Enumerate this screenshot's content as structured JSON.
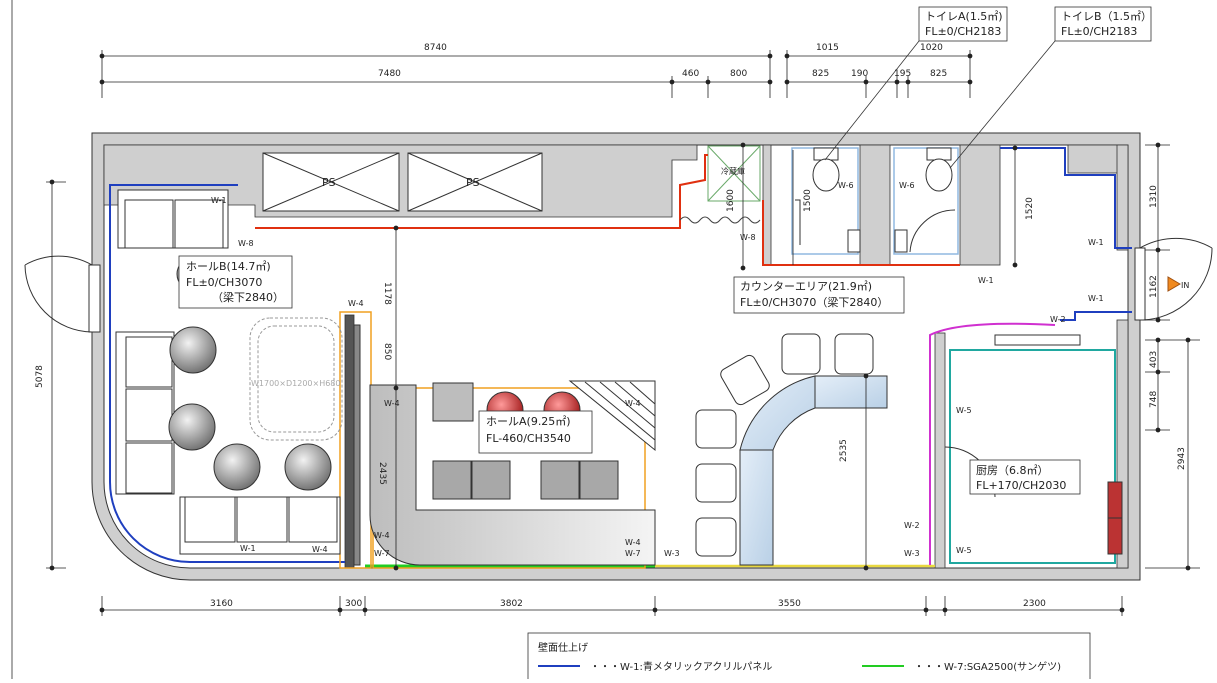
{
  "dims_top": {
    "d8740": "8740",
    "d1015": "1015",
    "d1020": "1020",
    "d7480": "7480",
    "d460": "460",
    "d800": "800",
    "d825a": "825",
    "d190": "190",
    "d195": "195",
    "d825b": "825"
  },
  "dims_bottom": {
    "d3160": "3160",
    "d300": "300",
    "d3802": "3802",
    "d3550": "3550",
    "d2300": "2300"
  },
  "dims_side": {
    "d5078": "5078",
    "d1310": "1310",
    "d1162": "1162",
    "d403": "403",
    "d748": "748",
    "d2943": "2943",
    "d1178": "1178",
    "d850": "850",
    "d2435": "2435",
    "d2535": "2535",
    "d1600": "1600",
    "d1500": "1500",
    "d1520": "1520"
  },
  "rooms": {
    "hallB": {
      "l1": "ホールB(14.7㎡)",
      "l2": "FL±0/CH3070",
      "l3": "（梁下2840）"
    },
    "hallA": {
      "l1": "ホールA(9.25㎡)",
      "l2": "FL-460/CH3540"
    },
    "counter": {
      "l1": "カウンターエリア(21.9㎡)",
      "l2": "FL±0/CH3070（梁下2840）"
    },
    "kitchen": {
      "l1": "厨房（6.8㎡）",
      "l2": "FL+170/CH2030"
    },
    "toiletA": {
      "l1": "トイレA(1.5㎡)",
      "l2": "FL±0/CH2183"
    },
    "toiletB": {
      "l1": "トイレB（1.5㎡）",
      "l2": "FL±0/CH2183"
    }
  },
  "labels": {
    "ps": "PS",
    "fridge": "冷蔵庫",
    "entrance": "IN",
    "table_spec": "W1700×D1200×H680",
    "w1": "W-1",
    "w2": "W-2",
    "w3": "W-3",
    "w4": "W-4",
    "w5": "W-5",
    "w6": "W-6",
    "w7": "W-7",
    "w8": "W-8"
  },
  "legend": {
    "title": "壁面仕上げ",
    "item1": "・・・W-1:青メタリックアクリルパネル",
    "item2": "・・・W-7:SGA2500(サンゲツ)"
  },
  "colors": {
    "w1_blue": "#1f3fbf",
    "w7_green": "#22cc22",
    "w8_red": "#e03010",
    "w4_orange": "#f0a020",
    "w2_magenta": "#d030d0",
    "w3_yellow": "#e8d840",
    "w5_teal": "#20a8a0",
    "w6_lightblue": "#90b8e0"
  }
}
